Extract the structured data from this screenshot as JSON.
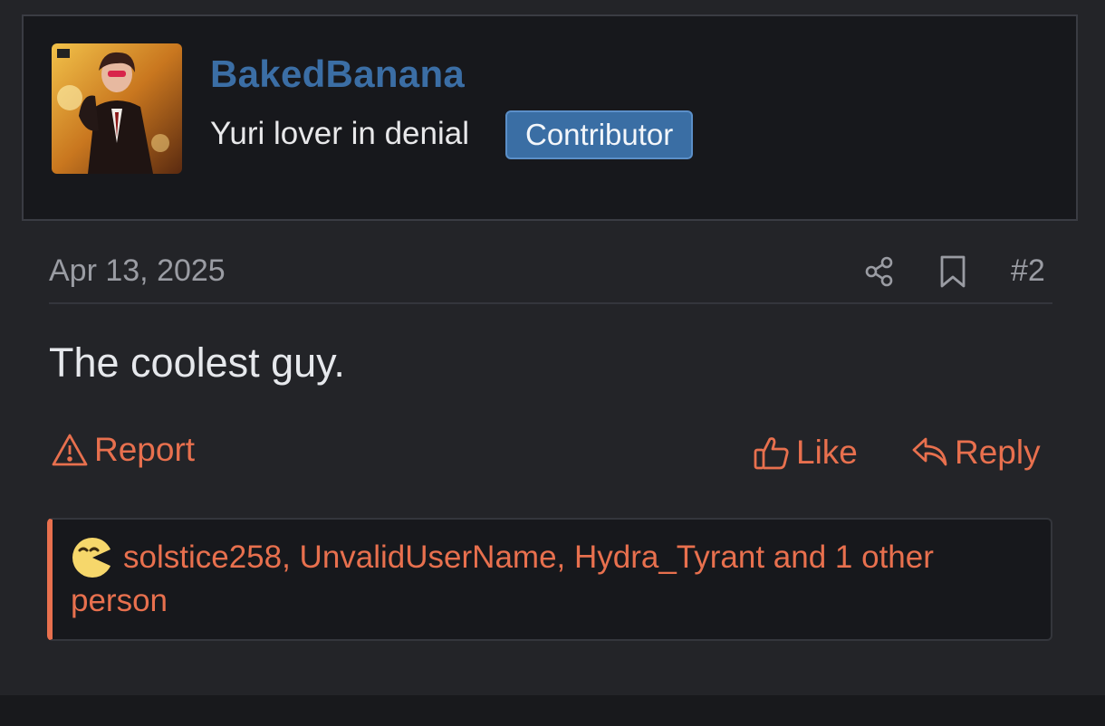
{
  "user": {
    "name": "BakedBanana",
    "title": "Yuri lover in denial",
    "badge": "Contributor",
    "avatar_icon": "user-avatar-image"
  },
  "post": {
    "date": "Apr 13, 2025",
    "number": "#2",
    "body": "The coolest guy.",
    "icons": {
      "share": "share-icon",
      "bookmark": "bookmark-icon"
    }
  },
  "actions": {
    "report": "Report",
    "like": "Like",
    "reply": "Reply"
  },
  "reactions": {
    "text": "solstice258, UnvalidUserName, Hydra_Tyrant and 1 other person",
    "icon": "laughing-emoji-icon"
  },
  "colors": {
    "background": "#232428",
    "card": "#17181c",
    "accent": "#e8704e",
    "username": "#3b6ea5",
    "badge": "#3a6ea4"
  }
}
